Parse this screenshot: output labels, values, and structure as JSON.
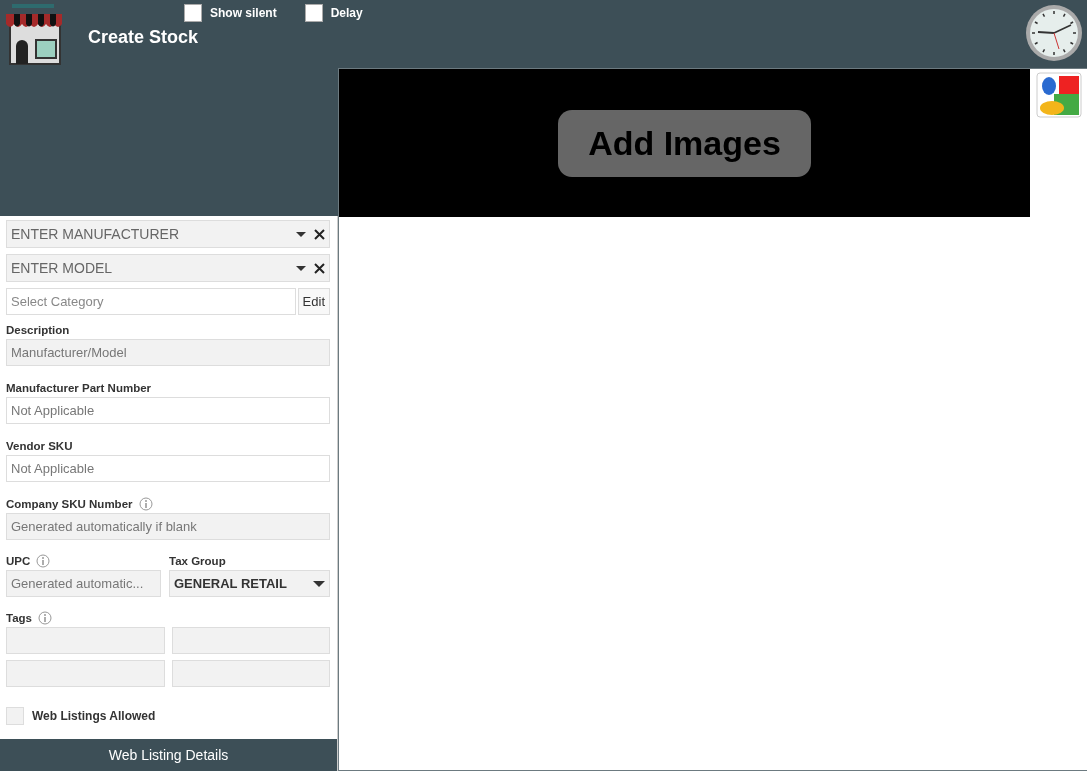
{
  "header": {
    "title": "Create Stock",
    "options": [
      {
        "label": "Show silent",
        "checked": false
      },
      {
        "label": "Delay",
        "checked": false
      }
    ]
  },
  "images": {
    "button": "Add Images"
  },
  "lookups": [
    {
      "placeholder": "ENTER MANUFACTURER"
    },
    {
      "placeholder": "ENTER MODEL"
    }
  ],
  "category": {
    "placeholder": "Select Category",
    "button": "Edit"
  },
  "fields": [
    {
      "label": "Description",
      "placeholder": "Manufacturer/Model",
      "disabled": true,
      "info": false
    },
    {
      "label": "Manufacturer Part Number",
      "placeholder": "Not Applicable",
      "disabled": false,
      "info": false
    },
    {
      "label": "Vendor SKU",
      "placeholder": "Not Applicable",
      "disabled": false,
      "info": false
    },
    {
      "label": "Company SKU Number",
      "placeholder": "Generated automatically if blank",
      "disabled": true,
      "info": true
    }
  ],
  "upc": {
    "label": "UPC",
    "placeholder": "Generated automatic...",
    "disabled": true,
    "info": true
  },
  "tax_group": {
    "label": "Tax Group",
    "value": "GENERAL RETAIL"
  },
  "tags": {
    "label": "Tags",
    "info": true,
    "fields": [
      {
        "disabled": true
      },
      {
        "disabled": true
      },
      {
        "disabled": true
      },
      {
        "disabled": true
      }
    ]
  },
  "web_listings": {
    "label": "Web Listings Allowed",
    "checked": false,
    "disabled": true
  },
  "details_button": "Web Listing Details"
}
